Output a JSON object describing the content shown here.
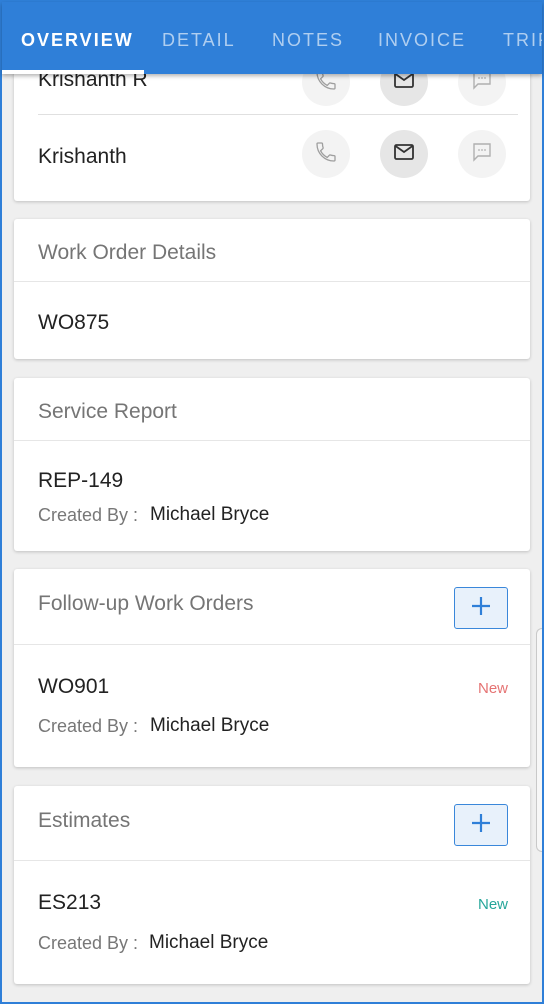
{
  "tabs": [
    {
      "label": "OVERVIEW",
      "active": true
    },
    {
      "label": "DETAIL",
      "active": false
    },
    {
      "label": "NOTES",
      "active": false
    },
    {
      "label": "INVOICE",
      "active": false
    },
    {
      "label": "TRIP",
      "active": false
    }
  ],
  "contacts": [
    {
      "name": "Krishanth R",
      "phone_icon": "phone-icon",
      "email_icon": "email-icon",
      "message_icon": "message-icon"
    },
    {
      "name": "Krishanth",
      "phone_icon": "phone-icon",
      "email_icon": "email-icon",
      "message_icon": "message-icon"
    }
  ],
  "work_order_details": {
    "title": "Work Order Details",
    "work_order": "WO875"
  },
  "service_report": {
    "title": "Service Report",
    "report_id": "REP-149",
    "created_by_label": "Created By :",
    "created_by": "Michael Bryce"
  },
  "followup_work_orders": {
    "title": "Follow-up Work Orders",
    "add_icon": "plus-icon",
    "item": {
      "id": "WO901",
      "status": "New",
      "created_by_label": "Created By :",
      "created_by": "Michael Bryce"
    }
  },
  "estimates": {
    "title": "Estimates",
    "add_icon": "plus-icon",
    "item": {
      "id": "ES213",
      "status": "New",
      "created_by_label": "Created By :",
      "created_by": "Michael Bryce"
    }
  },
  "colors": {
    "accent": "#2f7fd8",
    "status_followup": "#e57373",
    "status_estimate": "#26a69a"
  }
}
